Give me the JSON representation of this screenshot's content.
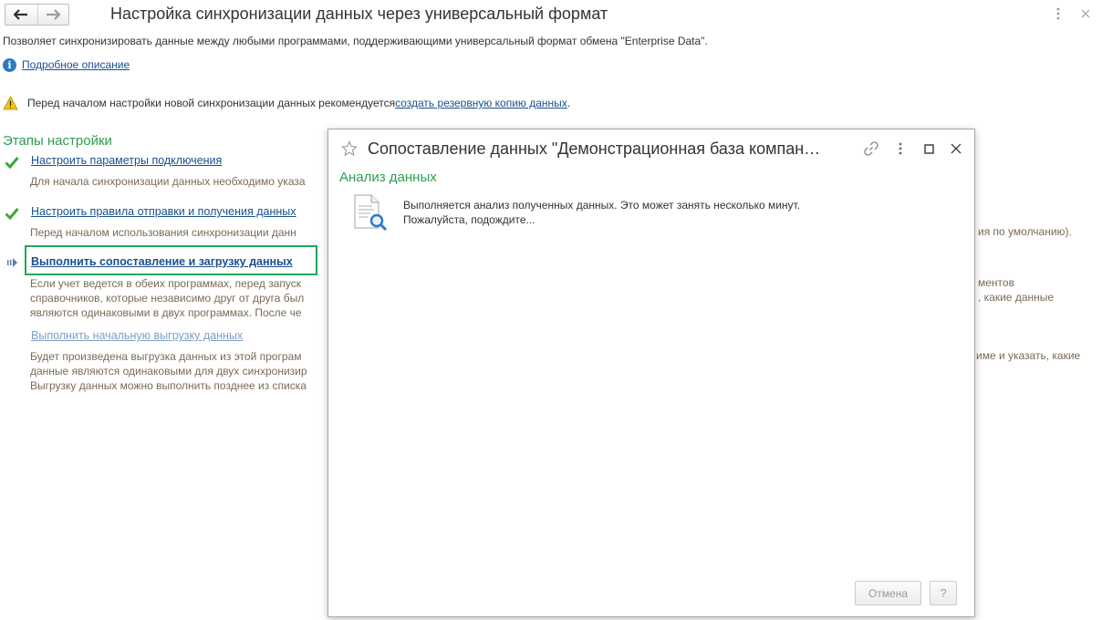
{
  "window": {
    "title": "Настройка синхронизации данных через универсальный формат",
    "description": "Позволяет синхронизировать данные между любыми программами, поддерживающими универсальный формат обмена \"Enterprise Data\".",
    "details_link": "Подробное описание",
    "warning_text": "Перед началом настройки новой синхронизации данных рекомендуется ",
    "warning_link": "создать резервную копию данных",
    "warning_end": "."
  },
  "stages": {
    "title": "Этапы настройки",
    "step1": {
      "link": "Настроить параметры подключения",
      "text": "Для начала синхронизации данных необходимо указа"
    },
    "step2": {
      "link": "Настроить правила отправки и получения данных",
      "text": "Перед началом использования синхронизации данн",
      "text_right": "ия по умолчанию)."
    },
    "step3": {
      "link": "Выполнить сопоставление и загрузку данных",
      "lines": [
        "Если учет ведется в обеих программах, перед запуск",
        "справочников, которые независимо друг от друга был",
        "являются одинаковыми в двух программах. После че"
      ],
      "right_lines": [
        "ментов",
        ", какие данные"
      ]
    },
    "step4": {
      "link": "Выполнить начальную выгрузку данных",
      "lines": [
        "Будет произведена выгрузка данных из этой програм",
        "данные являются одинаковыми для двух синхронизир",
        "Выгрузку данных можно выполнить позднее из списка"
      ],
      "right_lines": [
        "име и указать, какие"
      ]
    }
  },
  "dialog": {
    "title": "Сопоставление данных \"Демонстрационная база компан…",
    "section": "Анализ данных",
    "message_line1": "Выполняется анализ полученных данных. Это может занять несколько минут.",
    "message_line2": "Пожалуйста, подождите...",
    "cancel_label": "Отмена",
    "help_label": "?"
  },
  "colors": {
    "accent_green": "#2e9e4f",
    "link_blue": "#1a4f8f",
    "highlight_box": "#1fa85a"
  }
}
